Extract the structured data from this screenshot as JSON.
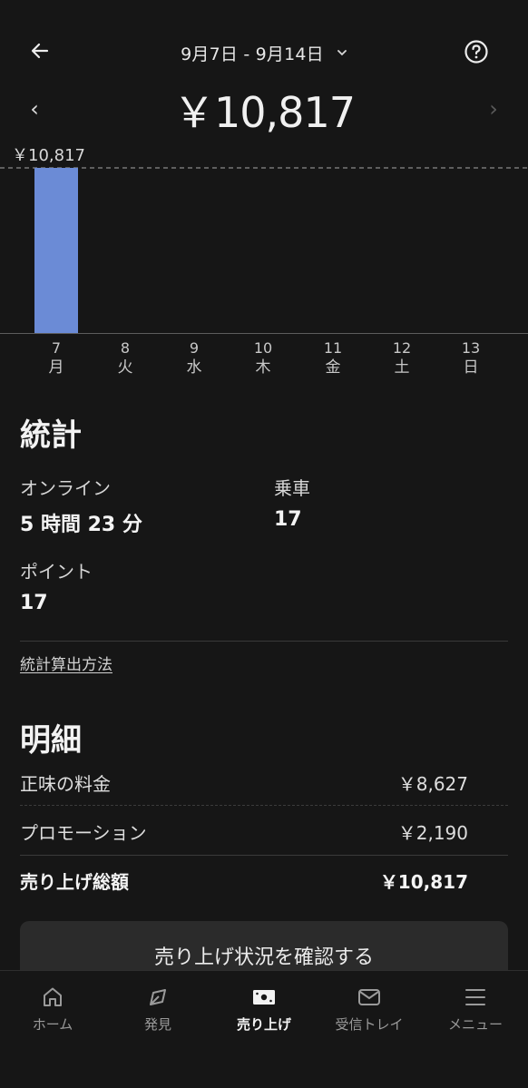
{
  "header": {
    "date_range": "9月7日 - 9月14日",
    "total": "￥10,817",
    "prev_glyph": "‹",
    "next_glyph": "›"
  },
  "chart_data": {
    "type": "bar",
    "categories": [
      "7 月",
      "8 火",
      "9 水",
      "10 木",
      "11 金",
      "12 土",
      "13 日"
    ],
    "values": [
      10817,
      0,
      0,
      0,
      0,
      0,
      0
    ],
    "ylim": [
      0,
      10817
    ],
    "reference_line": {
      "value": 10817,
      "label": "￥10,817",
      "style": "dashed"
    },
    "bar_color": "#6b8bd6",
    "grid": false
  },
  "days": [
    {
      "num": "7",
      "name": "月"
    },
    {
      "num": "8",
      "name": "火"
    },
    {
      "num": "9",
      "name": "水"
    },
    {
      "num": "10",
      "name": "木"
    },
    {
      "num": "11",
      "name": "金"
    },
    {
      "num": "12",
      "name": "土"
    },
    {
      "num": "13",
      "name": "日"
    }
  ],
  "stats": {
    "title": "統計",
    "online_label": "オンライン",
    "online_value": "5 時間 23 分",
    "rides_label": "乗車",
    "rides_value": "17",
    "points_label": "ポイント",
    "points_value": "17",
    "method_link": "統計算出方法"
  },
  "details": {
    "title": "明細",
    "rows": [
      {
        "label": "正味の料金",
        "value": "￥8,627"
      },
      {
        "label": "プロモーション",
        "value": "￥2,190"
      },
      {
        "label": "売り上げ総額",
        "value": "￥10,817"
      }
    ]
  },
  "cta": {
    "label": "売り上げ状況を確認する"
  },
  "nav": {
    "items": [
      {
        "label": "ホーム",
        "icon": "home-icon"
      },
      {
        "label": "発見",
        "icon": "discover-icon"
      },
      {
        "label": "売り上げ",
        "icon": "earnings-icon",
        "active": true
      },
      {
        "label": "受信トレイ",
        "icon": "inbox-icon"
      },
      {
        "label": "メニュー",
        "icon": "menu-icon"
      }
    ]
  },
  "colors": {
    "background": "#161616",
    "bar": "#6b8bd6",
    "card": "#2b2b2b"
  }
}
